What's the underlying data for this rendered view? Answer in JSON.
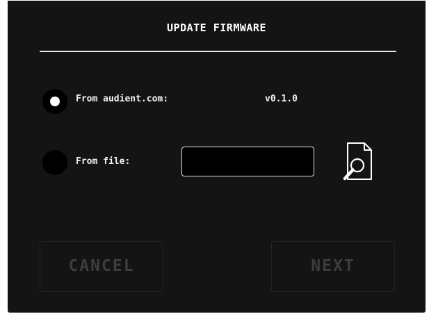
{
  "dialog": {
    "title": "UPDATE FIRMWARE"
  },
  "options": {
    "online": {
      "label": "From audient.com:",
      "version": "v0.1.0",
      "selected": true
    },
    "file": {
      "label": "From file:",
      "selected": false,
      "value": "",
      "placeholder": "",
      "browse_icon": "file-search-icon"
    }
  },
  "buttons": {
    "cancel_label": "CANCEL",
    "next_label": "NEXT"
  },
  "colors": {
    "background": "#141414",
    "text": "#ffffff",
    "disabled_text": "#3d3d3d"
  }
}
